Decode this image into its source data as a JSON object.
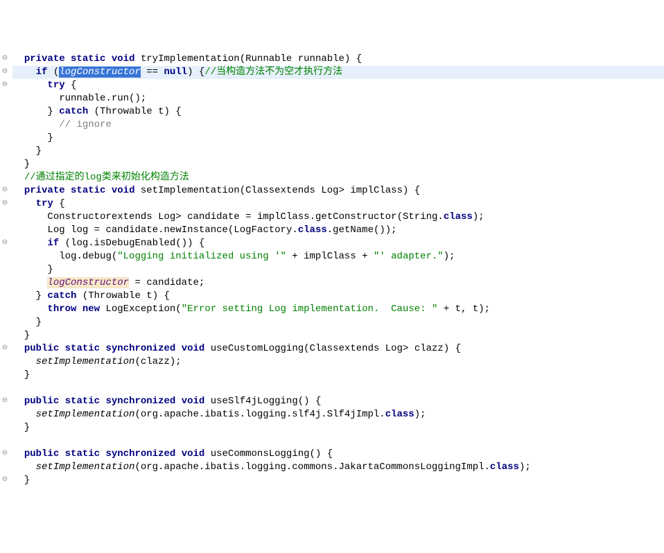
{
  "selection_text": "logConstructor",
  "usage_text": "logConstructor",
  "lines": [
    {
      "indent": 0,
      "html": "[[KW:private]] [[KW:static]] [[KW:void]] [[IDENT:tryImplementation]]([[TYPE:Runnable]] [[PARAM:runnable]]) {",
      "fold": true
    },
    {
      "indent": 1,
      "html": "[[KW:if]] ([[SELECTED]] == [[KW:null]]) {[[COMMENTCN://当构造方法不为空才执行方法]]",
      "highlight_line": true,
      "fold": true
    },
    {
      "indent": 2,
      "html": "[[KW:try]] {",
      "fold": true
    },
    {
      "indent": 3,
      "html": "[[PARAM:runnable]].run();"
    },
    {
      "indent": 2,
      "html": "} [[KW:catch]] ([[TYPE:Throwable]] [[PARAM:t]]) {"
    },
    {
      "indent": 3,
      "html": "[[COMMENT:// ignore]]"
    },
    {
      "indent": 2,
      "html": "}"
    },
    {
      "indent": 1,
      "html": "}"
    },
    {
      "indent": 0,
      "html": "}"
    },
    {
      "indent": 0,
      "html": "[[COMMENTCN://通过指定的log类来初始化构造方法]]"
    },
    {
      "indent": 0,
      "html": "[[KW:private]] [[KW:static]] [[KW:void]] [[IDENT:setImplementation]]([[TYPE:Class]]<? [[KWEXT:extends]] [[TYPE:Log]]> [[PARAM:implClass]]) {",
      "fold": true
    },
    {
      "indent": 1,
      "html": "[[KW:try]] {",
      "fold": true
    },
    {
      "indent": 2,
      "html": "[[TYPE:Constructor]]<? [[KWEXT:extends]] [[TYPE:Log]]> [[IDENT:candidate]] = [[PARAM:implClass]].getConstructor([[TYPE:String]].[[KW:class]]);"
    },
    {
      "indent": 2,
      "html": "[[TYPE:Log]] [[IDENT:log]] = [[IDENT:candidate]].newInstance([[TYPE:LogFactory]].[[KW:class]].getName());"
    },
    {
      "indent": 2,
      "html": "[[KW:if]] ([[IDENT:log]].isDebugEnabled()) {",
      "fold": true
    },
    {
      "indent": 3,
      "html": "[[IDENT:log]].debug([[STR:\"Logging initialized using '\"]] + [[PARAM:implClass]] + [[STR:\"' adapter.\"]]);"
    },
    {
      "indent": 2,
      "html": "}"
    },
    {
      "indent": 2,
      "html": "[[USAGE]] = [[IDENT:candidate]];"
    },
    {
      "indent": 1,
      "html": "} [[KW:catch]] ([[TYPE:Throwable]] [[PARAM:t]]) {"
    },
    {
      "indent": 2,
      "html": "[[KW:throw]] [[KW:new]] [[TYPE:LogException]]([[STR:\"Error setting Log implementation.  Cause: \"]] + [[PARAM:t]], [[PARAM:t]]);"
    },
    {
      "indent": 1,
      "html": "}"
    },
    {
      "indent": 0,
      "html": "}"
    },
    {
      "indent": 0,
      "html": "[[KW:public]] [[KW:static]] [[KW:synchronized]] [[KW:void]] [[IDENT:useCustomLogging]]([[TYPE:Class]]<? [[KWEXT:extends]] [[TYPE:Log]]> [[PARAM:clazz]]) {",
      "fold": true
    },
    {
      "indent": 1,
      "html": "[[CALLI:setImplementation]]([[PARAM:clazz]]);"
    },
    {
      "indent": 0,
      "html": "}"
    },
    {
      "indent": 0,
      "html": ""
    },
    {
      "indent": 0,
      "html": "[[KW:public]] [[KW:static]] [[KW:synchronized]] [[KW:void]] [[IDENT:useSlf4jLogging]]() {",
      "fold": true
    },
    {
      "indent": 1,
      "html": "[[CALLI:setImplementation]](org.apache.ibatis.logging.slf4j.Slf4jImpl.[[KW:class]]);"
    },
    {
      "indent": 0,
      "html": "}"
    },
    {
      "indent": 0,
      "html": ""
    },
    {
      "indent": 0,
      "html": "[[KW:public]] [[KW:static]] [[KW:synchronized]] [[KW:void]] [[IDENT:useCommonsLogging]]() {",
      "fold": true
    },
    {
      "indent": 1,
      "html": "[[CALLI:setImplementation]](org.apache.ibatis.logging.commons.JakartaCommonsLoggingImpl.[[KW:class]]);"
    },
    {
      "indent": 0,
      "html": "}",
      "fold": true
    }
  ]
}
